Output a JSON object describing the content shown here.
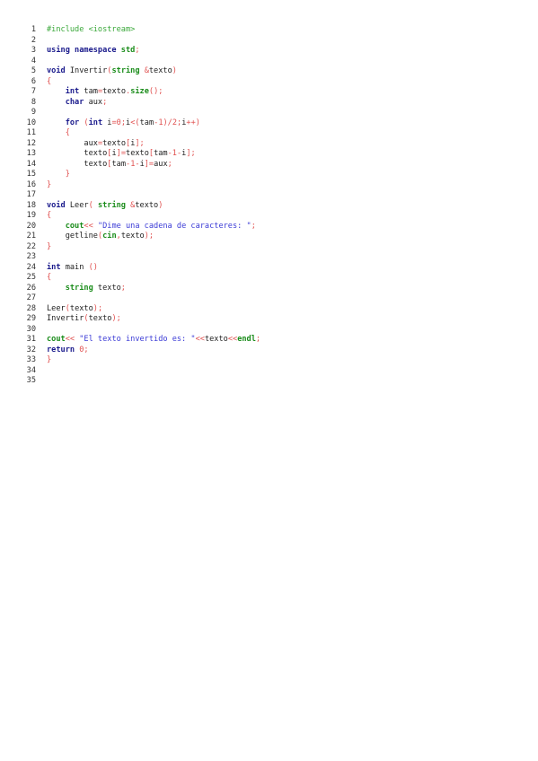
{
  "code_lines": [
    [
      {
        "t": "#include <iostream>",
        "c": "pp"
      }
    ],
    [],
    [
      {
        "t": "using namespace ",
        "c": "kw"
      },
      {
        "t": "std",
        "c": "ty"
      },
      {
        "t": ";",
        "c": "op"
      }
    ],
    [],
    [
      {
        "t": "void ",
        "c": "kw"
      },
      {
        "t": "Invertir",
        "c": "pl"
      },
      {
        "t": "(",
        "c": "op"
      },
      {
        "t": "string ",
        "c": "ty"
      },
      {
        "t": "&",
        "c": "op"
      },
      {
        "t": "texto",
        "c": "pl"
      },
      {
        "t": ")",
        "c": "op"
      }
    ],
    [
      {
        "t": "{",
        "c": "op"
      }
    ],
    [
      {
        "t": "    ",
        "c": "pl"
      },
      {
        "t": "int ",
        "c": "kw"
      },
      {
        "t": "tam",
        "c": "pl"
      },
      {
        "t": "=",
        "c": "op"
      },
      {
        "t": "texto",
        "c": "pl"
      },
      {
        "t": ".",
        "c": "op"
      },
      {
        "t": "size",
        "c": "ty"
      },
      {
        "t": "();",
        "c": "op"
      }
    ],
    [
      {
        "t": "    ",
        "c": "pl"
      },
      {
        "t": "char ",
        "c": "kw"
      },
      {
        "t": "aux",
        "c": "pl"
      },
      {
        "t": ";",
        "c": "op"
      }
    ],
    [],
    [
      {
        "t": "    ",
        "c": "pl"
      },
      {
        "t": "for ",
        "c": "kw"
      },
      {
        "t": "(",
        "c": "op"
      },
      {
        "t": "int ",
        "c": "kw"
      },
      {
        "t": "i",
        "c": "pl"
      },
      {
        "t": "=",
        "c": "op"
      },
      {
        "t": "0",
        "c": "nm"
      },
      {
        "t": ";",
        "c": "op"
      },
      {
        "t": "i",
        "c": "pl"
      },
      {
        "t": "<(",
        "c": "op"
      },
      {
        "t": "tam",
        "c": "pl"
      },
      {
        "t": "-",
        "c": "op"
      },
      {
        "t": "1",
        "c": "nm"
      },
      {
        "t": ")/",
        "c": "op"
      },
      {
        "t": "2",
        "c": "nm"
      },
      {
        "t": ";",
        "c": "op"
      },
      {
        "t": "i",
        "c": "pl"
      },
      {
        "t": "++)",
        "c": "op"
      }
    ],
    [
      {
        "t": "    ",
        "c": "pl"
      },
      {
        "t": "{",
        "c": "op"
      }
    ],
    [
      {
        "t": "        ",
        "c": "pl"
      },
      {
        "t": "aux",
        "c": "pl"
      },
      {
        "t": "=",
        "c": "op"
      },
      {
        "t": "texto",
        "c": "pl"
      },
      {
        "t": "[",
        "c": "op"
      },
      {
        "t": "i",
        "c": "pl"
      },
      {
        "t": "];",
        "c": "op"
      }
    ],
    [
      {
        "t": "        ",
        "c": "pl"
      },
      {
        "t": "texto",
        "c": "pl"
      },
      {
        "t": "[",
        "c": "op"
      },
      {
        "t": "i",
        "c": "pl"
      },
      {
        "t": "]=",
        "c": "op"
      },
      {
        "t": "texto",
        "c": "pl"
      },
      {
        "t": "[",
        "c": "op"
      },
      {
        "t": "tam",
        "c": "pl"
      },
      {
        "t": "-",
        "c": "op"
      },
      {
        "t": "1",
        "c": "nm"
      },
      {
        "t": "-",
        "c": "op"
      },
      {
        "t": "i",
        "c": "pl"
      },
      {
        "t": "];",
        "c": "op"
      }
    ],
    [
      {
        "t": "        ",
        "c": "pl"
      },
      {
        "t": "texto",
        "c": "pl"
      },
      {
        "t": "[",
        "c": "op"
      },
      {
        "t": "tam",
        "c": "pl"
      },
      {
        "t": "-",
        "c": "op"
      },
      {
        "t": "1",
        "c": "nm"
      },
      {
        "t": "-",
        "c": "op"
      },
      {
        "t": "i",
        "c": "pl"
      },
      {
        "t": "]=",
        "c": "op"
      },
      {
        "t": "aux",
        "c": "pl"
      },
      {
        "t": ";",
        "c": "op"
      }
    ],
    [
      {
        "t": "    ",
        "c": "pl"
      },
      {
        "t": "}",
        "c": "op"
      }
    ],
    [
      {
        "t": "}",
        "c": "op"
      }
    ],
    [],
    [
      {
        "t": "void ",
        "c": "kw"
      },
      {
        "t": "Leer",
        "c": "pl"
      },
      {
        "t": "( ",
        "c": "op"
      },
      {
        "t": "string ",
        "c": "ty"
      },
      {
        "t": "&",
        "c": "op"
      },
      {
        "t": "texto",
        "c": "pl"
      },
      {
        "t": ")",
        "c": "op"
      }
    ],
    [
      {
        "t": "{",
        "c": "op"
      }
    ],
    [
      {
        "t": "    ",
        "c": "pl"
      },
      {
        "t": "cout",
        "c": "ty"
      },
      {
        "t": "<< ",
        "c": "op"
      },
      {
        "t": "\"Dime una cadena de caracteres: \"",
        "c": "st"
      },
      {
        "t": ";",
        "c": "op"
      }
    ],
    [
      {
        "t": "    ",
        "c": "pl"
      },
      {
        "t": "getline",
        "c": "pl"
      },
      {
        "t": "(",
        "c": "op"
      },
      {
        "t": "cin",
        "c": "ty"
      },
      {
        "t": ",",
        "c": "op"
      },
      {
        "t": "texto",
        "c": "pl"
      },
      {
        "t": ");",
        "c": "op"
      }
    ],
    [
      {
        "t": "}",
        "c": "op"
      }
    ],
    [],
    [
      {
        "t": "int ",
        "c": "kw"
      },
      {
        "t": "main ",
        "c": "pl"
      },
      {
        "t": "()",
        "c": "op"
      }
    ],
    [
      {
        "t": "{",
        "c": "op"
      }
    ],
    [
      {
        "t": "    ",
        "c": "pl"
      },
      {
        "t": "string ",
        "c": "ty"
      },
      {
        "t": "texto",
        "c": "pl"
      },
      {
        "t": ";",
        "c": "op"
      }
    ],
    [],
    [
      {
        "t": "Leer",
        "c": "pl"
      },
      {
        "t": "(",
        "c": "op"
      },
      {
        "t": "texto",
        "c": "pl"
      },
      {
        "t": ");",
        "c": "op"
      }
    ],
    [
      {
        "t": "Invertir",
        "c": "pl"
      },
      {
        "t": "(",
        "c": "op"
      },
      {
        "t": "texto",
        "c": "pl"
      },
      {
        "t": ");",
        "c": "op"
      }
    ],
    [],
    [
      {
        "t": "cout",
        "c": "ty"
      },
      {
        "t": "<< ",
        "c": "op"
      },
      {
        "t": "\"El texto invertido es: \"",
        "c": "st"
      },
      {
        "t": "<<",
        "c": "op"
      },
      {
        "t": "texto",
        "c": "pl"
      },
      {
        "t": "<<",
        "c": "op"
      },
      {
        "t": "endl",
        "c": "ty"
      },
      {
        "t": ";",
        "c": "op"
      }
    ],
    [
      {
        "t": "return ",
        "c": "kw"
      },
      {
        "t": "0",
        "c": "nm"
      },
      {
        "t": ";",
        "c": "op"
      }
    ],
    [
      {
        "t": "}",
        "c": "op"
      }
    ],
    [],
    []
  ]
}
